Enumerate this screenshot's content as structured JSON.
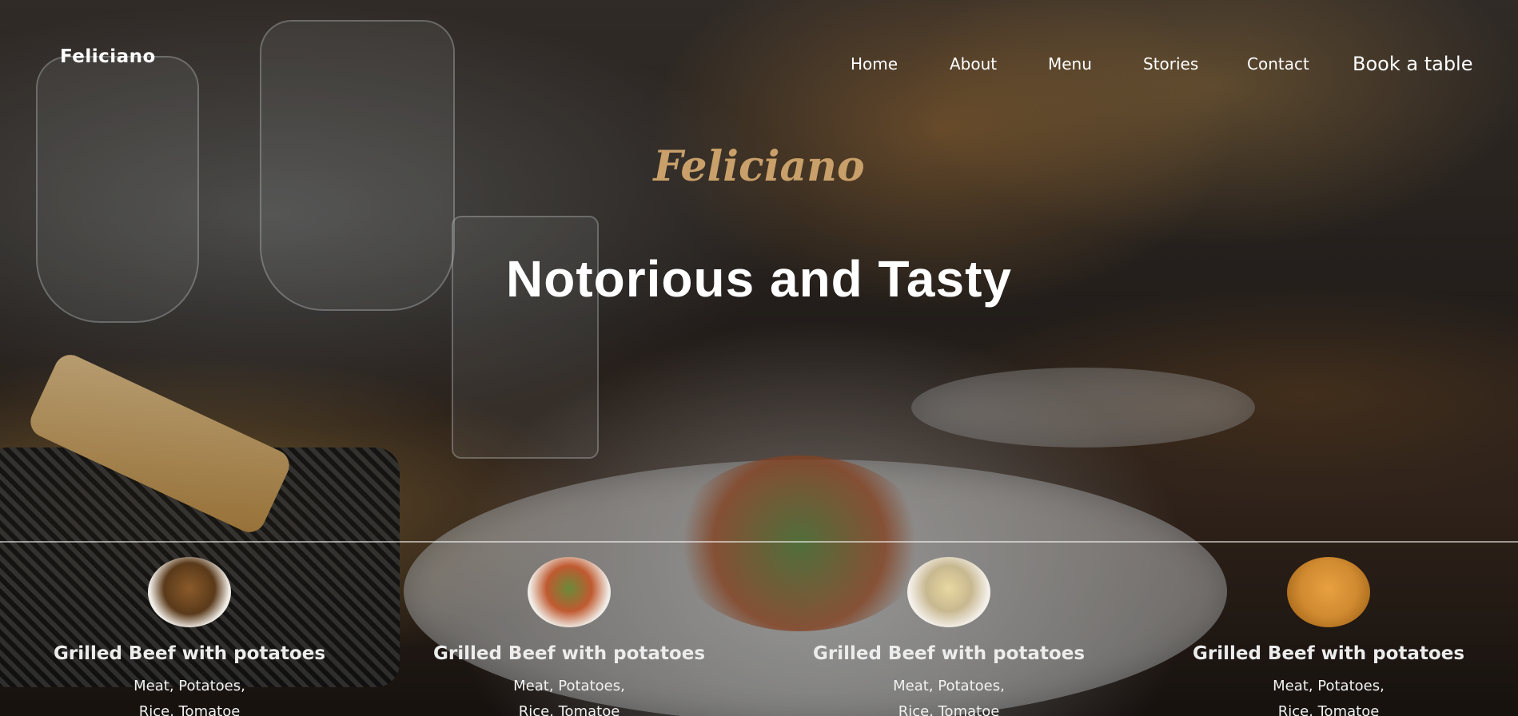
{
  "brand": "Feliciano",
  "nav": {
    "items": [
      "Home",
      "About",
      "Menu",
      "Stories",
      "Contact"
    ],
    "book": "Book a table"
  },
  "hero": {
    "script_logo": "Feliciano",
    "headline": "Notorious and Tasty"
  },
  "dishes": [
    {
      "title": "Grilled Beef with potatoes",
      "line1": "Meat, Potatoes,",
      "line2": "Rice, Tomatoe"
    },
    {
      "title": "Grilled Beef with potatoes",
      "line1": "Meat, Potatoes,",
      "line2": "Rice, Tomatoe"
    },
    {
      "title": "Grilled Beef with potatoes",
      "line1": "Meat, Potatoes,",
      "line2": "Rice, Tomatoe"
    },
    {
      "title": "Grilled Beef with potatoes",
      "line1": "Meat, Potatoes,",
      "line2": "Rice, Tomatoe"
    }
  ],
  "colors": {
    "accent": "#c9a06a",
    "text": "#ffffff"
  }
}
